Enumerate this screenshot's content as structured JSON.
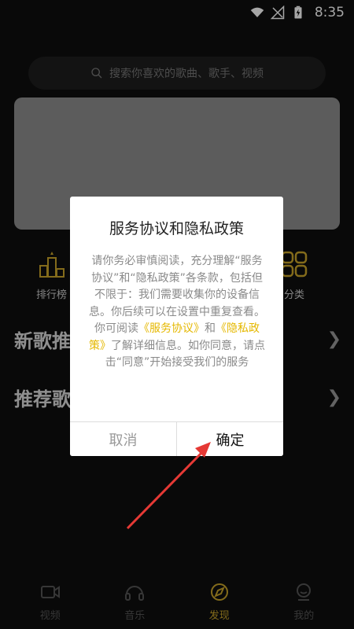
{
  "status_bar": {
    "time": "8:35"
  },
  "search": {
    "placeholder": "搜索你喜欢的歌曲、歌手、视频"
  },
  "quick_links": [
    {
      "label": "排行榜",
      "icon": "podium-icon"
    },
    {
      "label": "分类",
      "icon": "grid-icon"
    }
  ],
  "sections": [
    {
      "title": "新歌推荐"
    },
    {
      "title": "推荐歌单"
    }
  ],
  "dialog": {
    "title": "服务协议和隐私政策",
    "body_part1": "请你务必审慎阅读，充分理解“服务协议”和“隐私政策”各条款，包括但不限于：我们需要收集你的设备信息。你后续可以在设置中重复查看。你可阅读",
    "link1": "《服务协议》",
    "body_part2": "和",
    "link2": "《隐私政策》",
    "body_part3": "了解详细信息。如你同意，请点击“同意”开始接受我们的服务",
    "cancel_label": "取消",
    "confirm_label": "确定"
  },
  "bottom_nav": [
    {
      "label": "视频",
      "icon": "video-icon"
    },
    {
      "label": "音乐",
      "icon": "headphones-icon"
    },
    {
      "label": "发现",
      "icon": "discover-icon",
      "active": true
    },
    {
      "label": "我的",
      "icon": "profile-icon"
    }
  ],
  "colors": {
    "accent": "#c9a52a",
    "link": "#e5b800",
    "arrow": "#e53935"
  }
}
